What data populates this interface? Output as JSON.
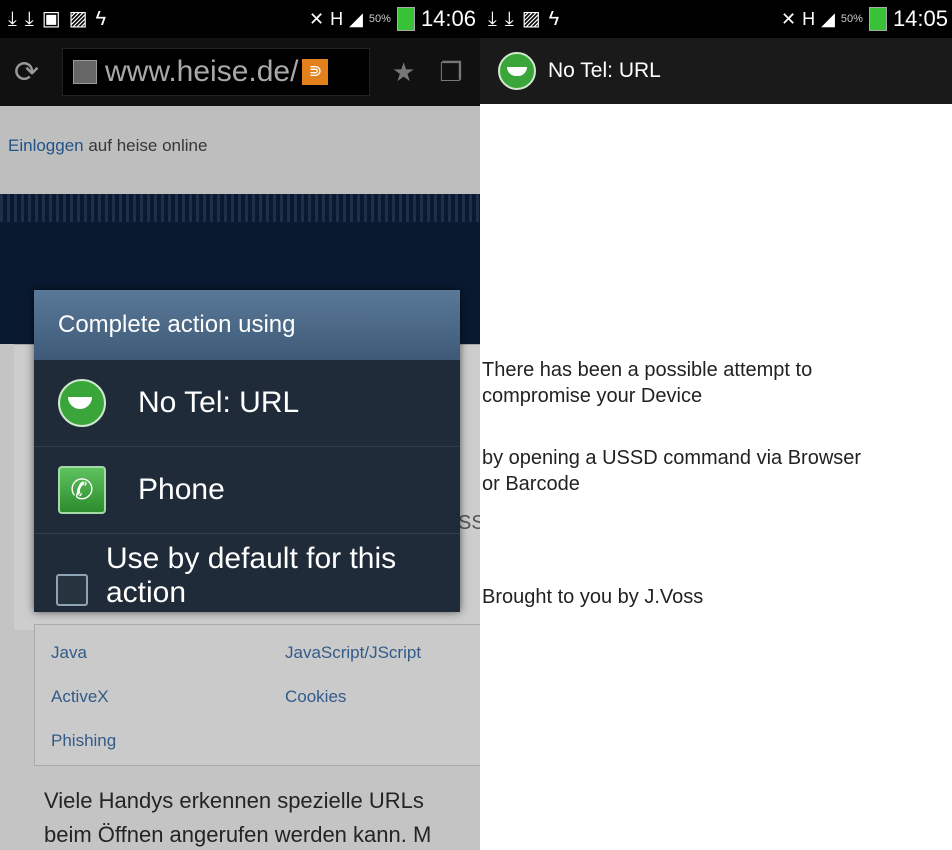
{
  "left": {
    "statusbar": {
      "battery_pct": "50%",
      "time": "14:06"
    },
    "url": "www.heise.de/",
    "login": {
      "link": "Einloggen",
      "rest": " auf heise online"
    },
    "cut_text": "SS",
    "tags": [
      "Java",
      "JavaScript/JScript",
      "ActiveX",
      "Cookies",
      "Phishing"
    ],
    "article": {
      "line1": "Viele Handys erkennen spezielle URLs",
      "line2": "beim Öffnen angerufen werden kann. M"
    },
    "dialog": {
      "title": "Complete action using",
      "options": [
        "No Tel: URL",
        "Phone"
      ],
      "default_label": "Use by default for this action",
      "default_checked": false
    }
  },
  "right": {
    "statusbar": {
      "battery_pct": "50%",
      "time": "14:05"
    },
    "app_title": "No Tel: URL",
    "messages": {
      "line1": "There has been a possible attempt to",
      "line2": "compromise your Device",
      "line3": " by opening a USSD command via Browser",
      "line4": "or Barcode",
      "line5": "Brought to you by J.Voss"
    }
  }
}
